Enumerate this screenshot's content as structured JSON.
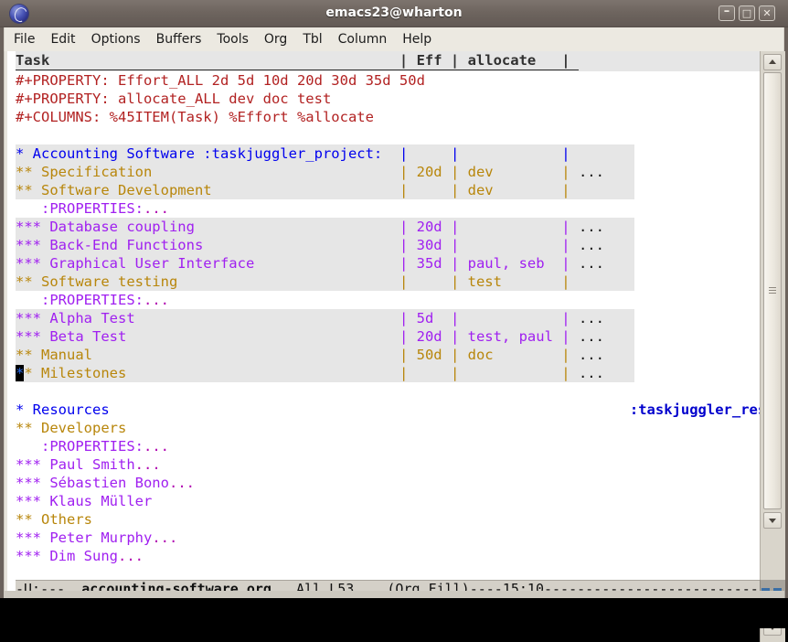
{
  "window": {
    "title": "emacs23@wharton",
    "icon": "emacs-icon",
    "controls": {
      "minimize": "–",
      "maximize": "□",
      "close": "✕"
    }
  },
  "menubar": {
    "items": [
      "File",
      "Edit",
      "Options",
      "Buffers",
      "Tools",
      "Org",
      "Tbl",
      "Column",
      "Help"
    ]
  },
  "header_line": {
    "task": "Task                                         ",
    "sep1": "| ",
    "eff": "Eff",
    "sep2": " | ",
    "allocate": "allocate  ",
    "sep3": " | "
  },
  "buffer": {
    "lines": [
      {
        "kind": "keyword",
        "text": "#+PROPERTY: Effort_ALL 2d 5d 10d 20d 30d 35d 50d"
      },
      {
        "kind": "keyword",
        "text": "#+PROPERTY: allocate_ALL dev doc test"
      },
      {
        "kind": "keyword",
        "text": "#+COLUMNS: %45ITEM(Task) %Effort %allocate"
      },
      {
        "kind": "blank",
        "text": ""
      },
      {
        "kind": "col",
        "level": 1,
        "item": "* Accounting Software :taskjuggler_project:",
        "eff": "",
        "alloc": "",
        "ellipsis": false
      },
      {
        "kind": "col",
        "level": 2,
        "item": "** Specification",
        "eff": "20d",
        "alloc": "dev",
        "ellipsis": true
      },
      {
        "kind": "col",
        "level": 2,
        "item": "** Software Development",
        "eff": "",
        "alloc": "dev",
        "ellipsis": false
      },
      {
        "kind": "props",
        "text": "   :PROPERTIES:",
        "ell": "..."
      },
      {
        "kind": "col",
        "level": 3,
        "item": "*** Database coupling",
        "eff": "20d",
        "alloc": "",
        "ellipsis": true
      },
      {
        "kind": "col",
        "level": 3,
        "item": "*** Back-End Functions",
        "eff": "30d",
        "alloc": "",
        "ellipsis": true
      },
      {
        "kind": "col",
        "level": 3,
        "item": "*** Graphical User Interface",
        "eff": "35d",
        "alloc": "paul, seb",
        "ellipsis": true
      },
      {
        "kind": "col",
        "level": 2,
        "item": "** Software testing",
        "eff": "",
        "alloc": "test",
        "ellipsis": false
      },
      {
        "kind": "props",
        "text": "   :PROPERTIES:",
        "ell": "..."
      },
      {
        "kind": "col",
        "level": 3,
        "item": "*** Alpha Test",
        "eff": "5d",
        "alloc": "",
        "ellipsis": true
      },
      {
        "kind": "col",
        "level": 3,
        "item": "*** Beta Test",
        "eff": "20d",
        "alloc": "test, paul",
        "ellipsis": true
      },
      {
        "kind": "col",
        "level": 2,
        "item": "** Manual",
        "eff": "50d",
        "alloc": "doc",
        "ellipsis": true
      },
      {
        "kind": "col-cursor",
        "level": 2,
        "cursor_char": "*",
        "item": "* Milestones",
        "eff": "",
        "alloc": "",
        "ellipsis": true
      },
      {
        "kind": "blank",
        "text": ""
      },
      {
        "kind": "head-tag",
        "level": 1,
        "text": "* Resources",
        "tag": ":taskjuggler_resource:"
      },
      {
        "kind": "head",
        "level": 2,
        "text": "** Developers"
      },
      {
        "kind": "props",
        "text": "   :PROPERTIES:",
        "ell": "..."
      },
      {
        "kind": "head-ell",
        "level": 3,
        "text": "*** Paul Smith",
        "ell": "..."
      },
      {
        "kind": "head-ell",
        "level": 3,
        "text": "*** Sébastien Bono",
        "ell": "..."
      },
      {
        "kind": "head",
        "level": 3,
        "text": "*** Klaus Müller"
      },
      {
        "kind": "head",
        "level": 2,
        "text": "** Others"
      },
      {
        "kind": "head-ell",
        "level": 3,
        "text": "*** Peter Murphy",
        "ell": "..."
      },
      {
        "kind": "head-ell",
        "level": 3,
        "text": "*** Dim Sung",
        "ell": "..."
      }
    ]
  },
  "modeline": {
    "prefix": "-U:---  ",
    "buffer_name": "accounting-software.org",
    "position": "   All L53    (Org Fill)----",
    "time": "15:10",
    "filler": "--------------------------"
  },
  "colors": {
    "level1": "#0000ee",
    "level2": "#b8860b",
    "level3": "#a020f0",
    "keyword": "#b22222",
    "column_bg": "#e6e6e6",
    "modeline_bg": "#d4d0c8",
    "titlebar_bg": "#6e655f"
  }
}
